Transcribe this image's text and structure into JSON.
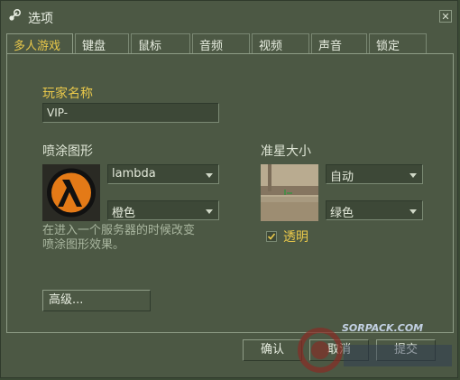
{
  "window": {
    "title": "选项"
  },
  "tabs": [
    {
      "label": "多人游戏",
      "active": true
    },
    {
      "label": "键盘"
    },
    {
      "label": "鼠标"
    },
    {
      "label": "音频"
    },
    {
      "label": "视频"
    },
    {
      "label": "声音"
    },
    {
      "label": "锁定"
    }
  ],
  "multiplayer": {
    "player_name_label": "玩家名称",
    "player_name_value": "VIP-",
    "spray_label": "喷涂图形",
    "spray_image_value": "lambda",
    "spray_color_value": "橙色",
    "spray_help_line1": "在进入一个服务器的时候改变",
    "spray_help_line2": "喷涂图形效果。",
    "crosshair_label": "准星大小",
    "crosshair_size_value": "自动",
    "crosshair_color_value": "绿色",
    "translucent_label": "透明",
    "translucent_checked": true,
    "advanced_button": "高级..."
  },
  "footer": {
    "ok_button": "确认",
    "cancel_button": "取消",
    "apply_button": "提交"
  },
  "watermark": {
    "site": "SORPACK.COM"
  },
  "colors": {
    "accent": "#e9c84a",
    "panel_bg": "#4c5844",
    "field_bg": "#3d4837"
  }
}
